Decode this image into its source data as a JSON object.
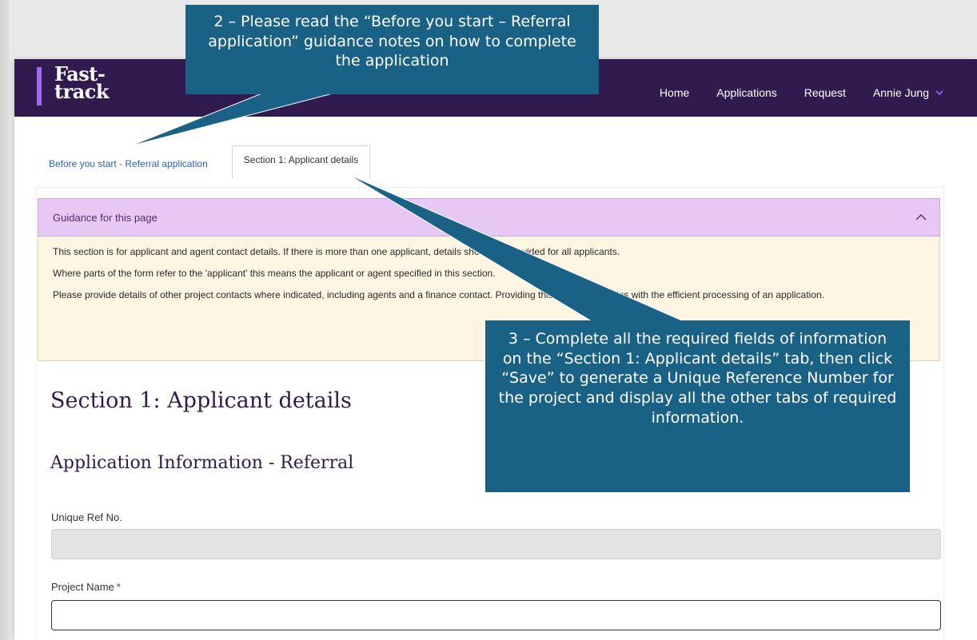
{
  "app": {
    "brand_line1": "Fast-",
    "brand_line2": "track",
    "colors": {
      "topbar": "#311b4e",
      "brand_accent": "#9b6cf0",
      "callout": "#1a6285",
      "guidance_header": "#e7c7f4",
      "guidance_body": "#fef5e2"
    }
  },
  "nav": {
    "home": "Home",
    "applications": "Applications",
    "request": "Request",
    "user": "Annie Jung"
  },
  "tabs": {
    "before_start": "Before you start - Referral application",
    "section1": "Section 1: Applicant details"
  },
  "guidance": {
    "header": "Guidance for this page",
    "p1": "This section is for applicant and agent contact details. If there is more than one applicant, details should be provided for all applicants.",
    "p2": "Where parts of the form refer to the 'applicant' this means the applicant or agent specified in this section.",
    "p3": "Please provide details of other project contacts where indicated, including agents and a finance contact. Providing this information helps with the efficient processing of an application."
  },
  "form": {
    "section_title": "Section 1: Applicant details",
    "subsection_title": "Application Information - Referral",
    "unique_ref_label": "Unique Ref No.",
    "unique_ref_value": "",
    "project_name_label": "Project Name",
    "required_marker": "*",
    "project_name_value": ""
  },
  "callouts": {
    "c2": "2 – Please read the “Before you start – Referral application” guidance notes on how to complete the application",
    "c3": "3 – Complete all the required fields of information on the “Section 1: Applicant details” tab, then click “Save” to generate a Unique Reference Number for the project and display all the other tabs of required information."
  },
  "icons": {
    "user_menu": "chevron-down-icon",
    "guidance_toggle": "chevron-up-icon"
  }
}
